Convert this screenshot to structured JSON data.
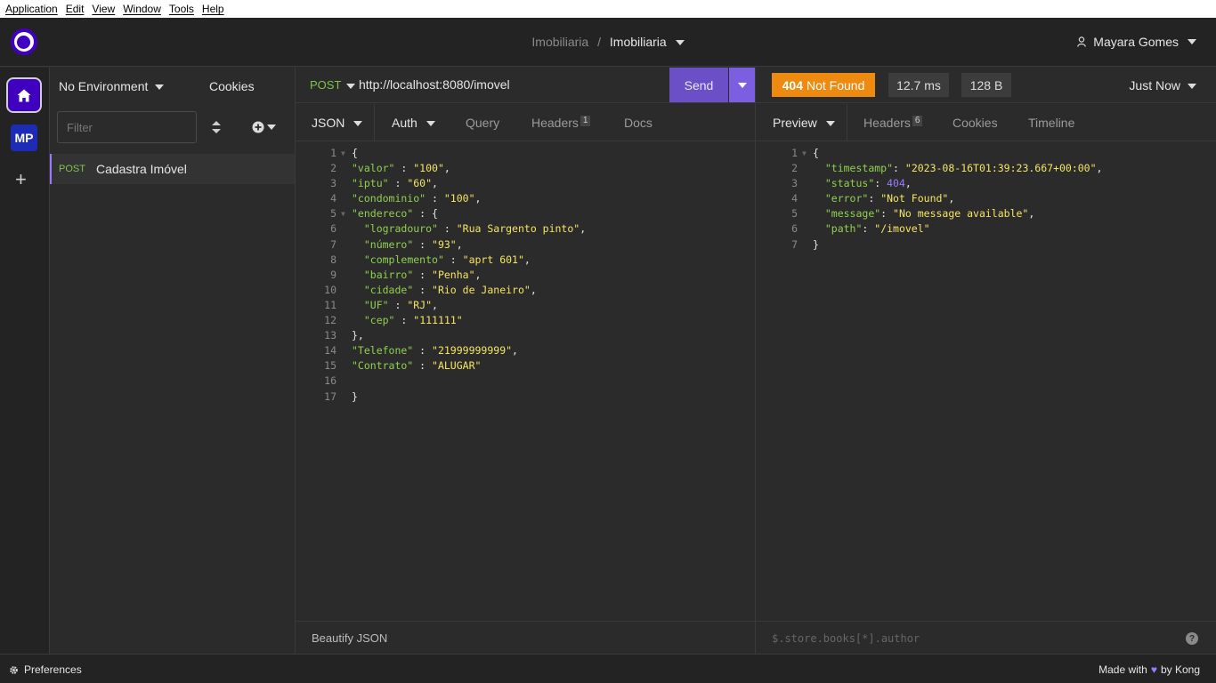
{
  "menubar": [
    "Application",
    "Edit",
    "View",
    "Window",
    "Tools",
    "Help"
  ],
  "header": {
    "project": "Imobiliaria",
    "separator": "/",
    "collection": "Imobiliaria",
    "user": "Mayara Gomes"
  },
  "rail": {
    "workspace_initials": "MP"
  },
  "sidebar": {
    "environment": "No Environment",
    "cookies": "Cookies",
    "filter_placeholder": "Filter",
    "requests": [
      {
        "method": "POST",
        "name": "Cadastra Imóvel"
      }
    ]
  },
  "request": {
    "method": "POST",
    "url": "http://localhost:8080/imovel",
    "send_label": "Send",
    "tabs": {
      "json": "JSON",
      "auth": "Auth",
      "query": "Query",
      "headers": "Headers",
      "headers_count": "1",
      "docs": "Docs"
    },
    "body_lines": [
      [
        [
          "p",
          "{"
        ]
      ],
      [
        [
          "k",
          "\"valor\""
        ],
        [
          "p",
          " : "
        ],
        [
          "s",
          "\"100\""
        ],
        [
          "p",
          ","
        ]
      ],
      [
        [
          "k",
          "\"iptu\""
        ],
        [
          "p",
          " : "
        ],
        [
          "s",
          "\"60\""
        ],
        [
          "p",
          ","
        ]
      ],
      [
        [
          "k",
          "\"condominio\""
        ],
        [
          "p",
          " : "
        ],
        [
          "s",
          "\"100\""
        ],
        [
          "p",
          ","
        ]
      ],
      [
        [
          "k",
          "\"endereco\""
        ],
        [
          "p",
          " : {"
        ]
      ],
      [
        [
          "p",
          "  "
        ],
        [
          "k",
          "\"logradouro\""
        ],
        [
          "p",
          " : "
        ],
        [
          "s",
          "\"Rua Sargento pinto\""
        ],
        [
          "p",
          ","
        ]
      ],
      [
        [
          "p",
          "  "
        ],
        [
          "k",
          "\"número\""
        ],
        [
          "p",
          " : "
        ],
        [
          "s",
          "\"93\""
        ],
        [
          "p",
          ","
        ]
      ],
      [
        [
          "p",
          "  "
        ],
        [
          "k",
          "\"complemento\""
        ],
        [
          "p",
          " : "
        ],
        [
          "s",
          "\"aprt 601\""
        ],
        [
          "p",
          ","
        ]
      ],
      [
        [
          "p",
          "  "
        ],
        [
          "k",
          "\"bairro\""
        ],
        [
          "p",
          " : "
        ],
        [
          "s",
          "\"Penha\""
        ],
        [
          "p",
          ","
        ]
      ],
      [
        [
          "p",
          "  "
        ],
        [
          "k",
          "\"cidade\""
        ],
        [
          "p",
          " : "
        ],
        [
          "s",
          "\"Rio de Janeiro\""
        ],
        [
          "p",
          ","
        ]
      ],
      [
        [
          "p",
          "  "
        ],
        [
          "k",
          "\"UF\""
        ],
        [
          "p",
          " : "
        ],
        [
          "s",
          "\"RJ\""
        ],
        [
          "p",
          ","
        ]
      ],
      [
        [
          "p",
          "  "
        ],
        [
          "k",
          "\"cep\""
        ],
        [
          "p",
          " : "
        ],
        [
          "s",
          "\"111111\""
        ]
      ],
      [
        [
          "p",
          "},"
        ]
      ],
      [
        [
          "k",
          "\"Telefone\""
        ],
        [
          "p",
          " : "
        ],
        [
          "s",
          "\"21999999999\""
        ],
        [
          "p",
          ","
        ]
      ],
      [
        [
          "k",
          "\"Contrato\""
        ],
        [
          "p",
          " : "
        ],
        [
          "s",
          "\"ALUGAR\""
        ]
      ],
      [],
      [
        [
          "p",
          "}"
        ]
      ]
    ],
    "beautify": "Beautify JSON"
  },
  "response": {
    "status_code": "404",
    "status_text": "Not Found",
    "time": "12.7 ms",
    "size": "128 B",
    "when": "Just Now",
    "tabs": {
      "preview": "Preview",
      "headers": "Headers",
      "headers_count": "6",
      "cookies": "Cookies",
      "timeline": "Timeline"
    },
    "body_lines": [
      [
        [
          "p",
          "{"
        ]
      ],
      [
        [
          "p",
          "  "
        ],
        [
          "k",
          "\"timestamp\""
        ],
        [
          "p",
          ": "
        ],
        [
          "s",
          "\"2023-08-16T01:39:23.667+00:00\""
        ],
        [
          "p",
          ","
        ]
      ],
      [
        [
          "p",
          "  "
        ],
        [
          "k",
          "\"status\""
        ],
        [
          "p",
          ": "
        ],
        [
          "n",
          "404"
        ],
        [
          "p",
          ","
        ]
      ],
      [
        [
          "p",
          "  "
        ],
        [
          "k",
          "\"error\""
        ],
        [
          "p",
          ": "
        ],
        [
          "s",
          "\"Not Found\""
        ],
        [
          "p",
          ","
        ]
      ],
      [
        [
          "p",
          "  "
        ],
        [
          "k",
          "\"message\""
        ],
        [
          "p",
          ": "
        ],
        [
          "s",
          "\"No message available\""
        ],
        [
          "p",
          ","
        ]
      ],
      [
        [
          "p",
          "  "
        ],
        [
          "k",
          "\"path\""
        ],
        [
          "p",
          ": "
        ],
        [
          "s",
          "\"/imovel\""
        ]
      ],
      [
        [
          "p",
          "}"
        ]
      ]
    ],
    "filter_placeholder": "$.store.books[*].author"
  },
  "footer": {
    "preferences": "Preferences",
    "made_with": "Made with",
    "by": "by Kong"
  }
}
